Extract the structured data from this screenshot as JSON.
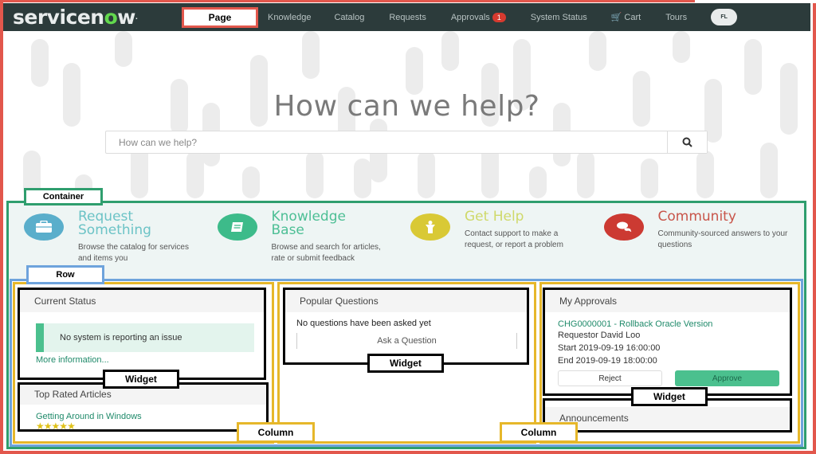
{
  "header": {
    "logo": {
      "prefix": "servicen",
      "accent": "o",
      "suffix": "w",
      "tm": "."
    },
    "nav": [
      {
        "label": "Page",
        "annotation": true
      },
      {
        "label": "Knowledge"
      },
      {
        "label": "Catalog"
      },
      {
        "label": "Requests"
      },
      {
        "label": "Approvals",
        "badge": "1"
      },
      {
        "label": "System Status"
      },
      {
        "label": "Cart",
        "icon": "cart-icon"
      },
      {
        "label": "Tours"
      }
    ],
    "avatar_initials": "FL"
  },
  "hero": {
    "title": "How can we help?",
    "search_placeholder": "How can we help?",
    "search_icon": "search-icon"
  },
  "annotations": {
    "container": "Container",
    "row": "Row",
    "widget": "Widget",
    "column": "Column"
  },
  "quicklinks": [
    {
      "title_line1": "Request",
      "title_line2": "Something",
      "description": "Browse the catalog for services and items you",
      "icon": "briefcase-icon",
      "color": "#5aaecb"
    },
    {
      "title_line1": "Knowledge",
      "title_line2": "Base",
      "description": "Browse and search for articles, rate or submit feedback",
      "icon": "book-icon",
      "color": "#3dbb8a"
    },
    {
      "title_line1": "Get Help",
      "title_line2": "",
      "description": "Contact support to make a request, or report a problem",
      "icon": "person-icon",
      "color": "#d9c935"
    },
    {
      "title_line1": "Community",
      "title_line2": "",
      "description": "Community-sourced answers to your questions",
      "icon": "chat-icon",
      "color": "#cc3a32"
    }
  ],
  "widgets": {
    "current_status": {
      "title": "Current Status",
      "message": "No system is reporting an issue",
      "link": "More information..."
    },
    "top_rated": {
      "title": "Top Rated Articles",
      "article": "Getting Around in Windows",
      "rating": 5,
      "rating_max": 5
    },
    "popular_questions": {
      "title": "Popular Questions",
      "empty": "No questions have been asked yet",
      "button": "Ask a Question"
    },
    "my_approvals": {
      "title": "My Approvals",
      "item": "CHG0000001 - Rollback Oracle Version",
      "requestor": "Requestor David Loo",
      "start": "Start 2019-09-19 16:00:00",
      "end": "End 2019-09-19 18:00:00",
      "reject": "Reject",
      "approve": "Approve"
    },
    "announcements": {
      "title": "Announcements"
    }
  }
}
